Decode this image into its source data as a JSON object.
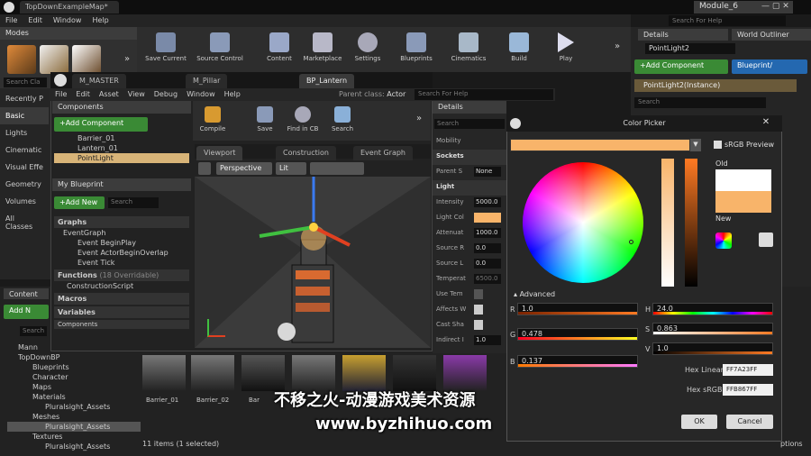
{
  "window": {
    "tab_title": "TopDownExampleMap*",
    "module_title": "Module_6",
    "menu": [
      "File",
      "Edit",
      "Window",
      "Help"
    ],
    "search_help_placeholder": "Search For Help"
  },
  "modes": {
    "title": "Modes",
    "search_placeholder": "Search Cla",
    "categories": [
      "Recently P",
      "Basic",
      "Lights",
      "Cinematic",
      "Visual Effe",
      "Geometry",
      "Volumes",
      "All Classes"
    ],
    "selected_index": 1
  },
  "toolbar": {
    "items": [
      "Save Current",
      "Source Control",
      "Content",
      "Marketplace",
      "Settings",
      "Blueprints",
      "Cinematics",
      "Build",
      "Play"
    ]
  },
  "blueprint_editor": {
    "tabs": [
      "M_MASTER",
      "M_Pillar",
      "BP_Lantern"
    ],
    "menu": [
      "File",
      "Edit",
      "Asset",
      "View",
      "Debug",
      "Window",
      "Help"
    ],
    "parent_class_label": "Parent class:",
    "parent_class_value": "Actor",
    "search_help_placeholder": "Search For Help",
    "components": {
      "title": "Components",
      "add_button": "+Add Component",
      "items": [
        "Barrier_01",
        "Lantern_01",
        "PointLight"
      ],
      "selected_index": 2
    },
    "my_blueprint": {
      "title": "My Blueprint",
      "add_new": "+Add New",
      "search_placeholder": "Search",
      "graphs_label": "Graphs",
      "event_graph": "EventGraph",
      "events": [
        "Event BeginPlay",
        "Event ActorBeginOverlap",
        "Event Tick"
      ],
      "functions_label": "Functions",
      "functions_count": "(18 Overridable)",
      "construction_script": "ConstructionScript",
      "macros_label": "Macros",
      "variables_label": "Variables",
      "components_label": "Components"
    },
    "bp_toolbar": [
      "Compile",
      "Save",
      "Find in CB",
      "Search"
    ],
    "editor_tabs": [
      "Viewport",
      "Construction",
      "Event Graph"
    ],
    "viewport_controls": [
      "Perspective",
      "Lit"
    ],
    "details": {
      "title": "Details",
      "search_placeholder": "Search",
      "mobility_label": "Mobility",
      "sockets_section": "Sockets",
      "parent_socket_label": "Parent S",
      "parent_socket_value": "None",
      "light_section": "Light",
      "rows": [
        {
          "label": "Intensity",
          "value": "5000.0"
        },
        {
          "label": "Light Col",
          "value": ""
        },
        {
          "label": "Attenuat",
          "value": "1000.0"
        },
        {
          "label": "Source R",
          "value": "0.0"
        },
        {
          "label": "Source L",
          "value": "0.0"
        },
        {
          "label": "Temperat",
          "value": "6500.0"
        },
        {
          "label": "Use Tem",
          "value": ""
        },
        {
          "label": "Affects W",
          "value": ""
        },
        {
          "label": "Cast Sha",
          "value": ""
        },
        {
          "label": "Indirect I",
          "value": "1.0"
        }
      ]
    }
  },
  "color_picker": {
    "title": "Color Picker",
    "srgb_preview": "sRGB Preview",
    "old_label": "Old",
    "new_label": "New",
    "advanced_label": "Advanced",
    "r_label": "R",
    "r_value": "1.0",
    "g_label": "G",
    "g_value": "0.478",
    "b_label": "B",
    "b_value": "0.137",
    "h_label": "H",
    "h_value": "24.0",
    "s_label": "S",
    "s_value": "0.863",
    "v_label": "V",
    "v_value": "1.0",
    "hex_linear_label": "Hex Linear",
    "hex_linear_value": "FF7A23FF",
    "hex_srgb_label": "Hex sRGB",
    "hex_srgb_value": "FFB867FF",
    "ok_label": "OK",
    "cancel_label": "Cancel",
    "colors": {
      "new": "#f8b46a",
      "old": "#ffffff"
    }
  },
  "right_panel": {
    "details_tab": "Details",
    "world_outliner_tab": "World Outliner",
    "selected_name": "PointLight2",
    "add_component": "+Add Component",
    "blueprint_button": "Blueprint/",
    "instance_label": "PointLight2(Instance)",
    "search_placeholder": "Search"
  },
  "content_browser": {
    "title": "Content",
    "add_new": "Add N",
    "search_placeholder": "Search",
    "folders": [
      "Mann",
      "TopDownBP",
      "Blueprints",
      "Character",
      "Maps",
      "Materials",
      "Pluralsight_Assets",
      "Meshes",
      "Pluralsight_Assets",
      "Textures",
      "Pluralsight_Assets"
    ],
    "thumbnails": [
      "Barrier_01",
      "Barrier_02",
      "Bar"
    ],
    "status": "11 items (1 selected)",
    "options_label": "ptions"
  },
  "watermark": {
    "line1": "不移之火-动漫游戏美术资源",
    "line2": "www.byzhihuo.com"
  }
}
